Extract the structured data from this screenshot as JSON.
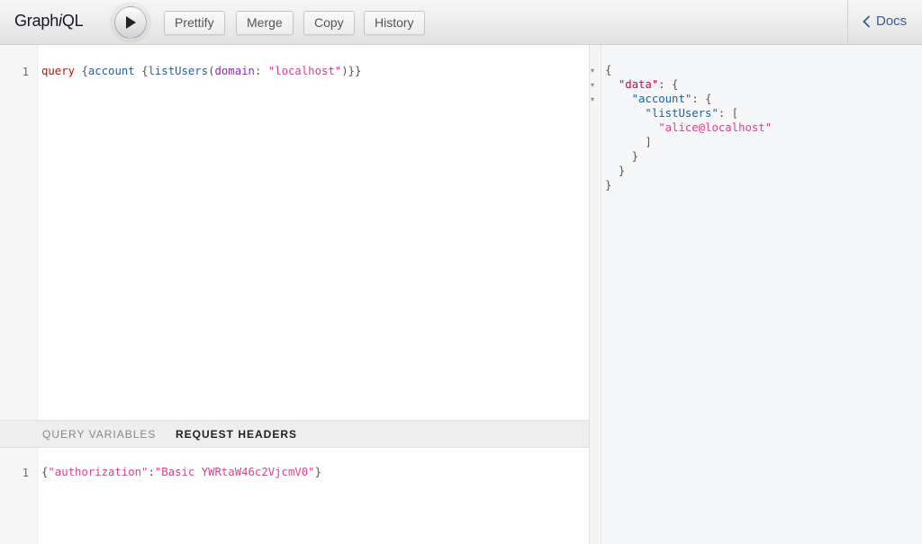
{
  "app": {
    "logo_pre": "Graph",
    "logo_em": "i",
    "logo_post": "QL"
  },
  "toolbar": {
    "run_icon": "play-icon",
    "prettify": "Prettify",
    "merge": "Merge",
    "copy": "Copy",
    "history": "History"
  },
  "docs": {
    "label": "Docs",
    "icon": "chevron-left-icon"
  },
  "query": {
    "line_number": "1",
    "tokens": {
      "kw": "query",
      "sp1": " ",
      "b1": "{",
      "f1": "account",
      "sp2": " ",
      "b2": "{",
      "f2": "listUsers",
      "p1": "(",
      "arg": "domain",
      "colon": ": ",
      "val": "\"localhost\"",
      "p2": ")",
      "b3": "}}"
    }
  },
  "tabs": {
    "variables": "Query Variables",
    "headers": "Request Headers"
  },
  "headers": {
    "line_number": "1",
    "tokens": {
      "b1": "{",
      "key": "\"authorization\"",
      "colon": ":",
      "val": "\"Basic YWRtaW46c2VjcmV0\"",
      "b2": "}"
    }
  },
  "result": {
    "fold_icon": "triangle-down-icon",
    "l1": "{",
    "l2_key": "\"data\"",
    "l2_rest": ": {",
    "l3_key": "\"account\"",
    "l3_rest": ": {",
    "l4_key": "\"listUsers\"",
    "l4_rest": ": [",
    "l5": "\"alice@localhost\"",
    "l6": "]",
    "l7": "}",
    "l8": "}",
    "l9": "}"
  },
  "colors": {
    "keyword": "#b11a04",
    "definition": "#d2054e",
    "property": "#1f61a0",
    "attribute": "#8b2bb9",
    "string": "#d64292",
    "link": "#3b5998"
  }
}
